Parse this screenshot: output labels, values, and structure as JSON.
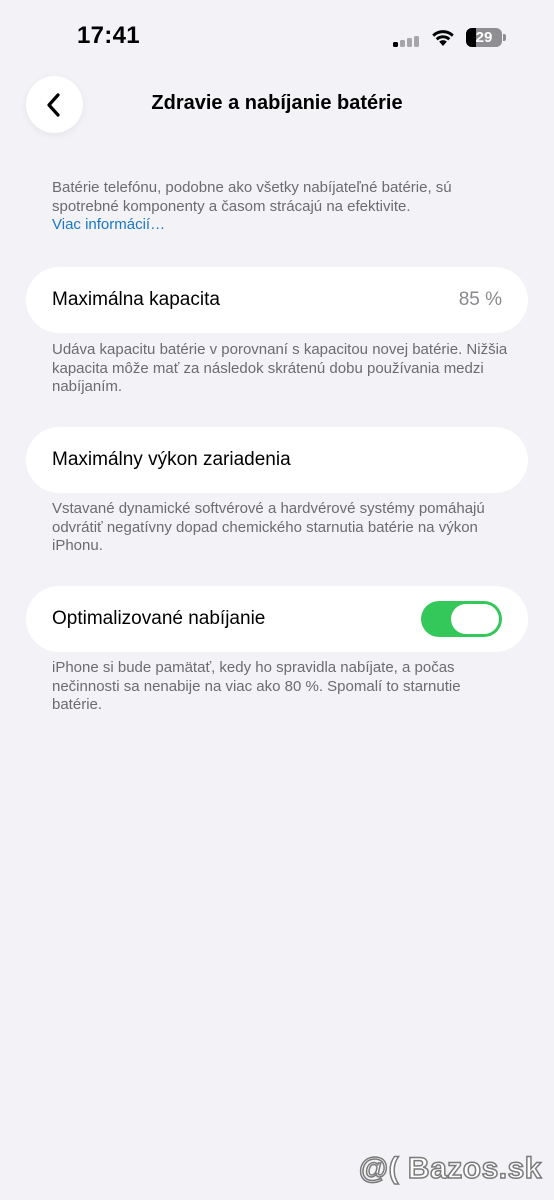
{
  "status_bar": {
    "time": "17:41",
    "battery_level": "29",
    "battery_fraction": 0.29,
    "icons": [
      "cellular-signal-icon",
      "wifi-icon",
      "battery-icon"
    ]
  },
  "header": {
    "back_icon": "chevron-left-icon",
    "title": "Zdravie a nabíjanie batérie"
  },
  "intro": {
    "text": "Batérie telefónu, podobne ako všetky nabíjateľné batérie, sú spotrebné komponenty a časom strácajú na efektivite.",
    "link": "Viac informácií…"
  },
  "max_capacity": {
    "label": "Maximálna kapacita",
    "value": "85 %",
    "note": "Udáva kapacitu batérie v porovnaní s kapacitou novej batérie. Nižšia kapacita môže mať za následok skrátenú dobu používania medzi nabíjaním."
  },
  "peak_performance": {
    "label": "Maximálny výkon zariadenia",
    "note": "Vstavané dynamické softvérové a hardvérové systémy pomáhajú odvrátiť negatívny dopad chemického starnutia batérie na výkon iPhonu."
  },
  "optimized_charging": {
    "label": "Optimalizované nabíjanie",
    "enabled": true,
    "note": "iPhone si bude pamätať, kedy ho spravidla nabíjate, a počas nečinnosti sa nenabije na viac ako 80 %. Spomalí to starnutie batérie."
  },
  "colors": {
    "background": "#f2f2f7",
    "card": "#ffffff",
    "link": "#1a78c2",
    "toggle_on": "#34c759",
    "secondary_text": "#6c6c70"
  },
  "watermark": "@( Bazos.sk"
}
